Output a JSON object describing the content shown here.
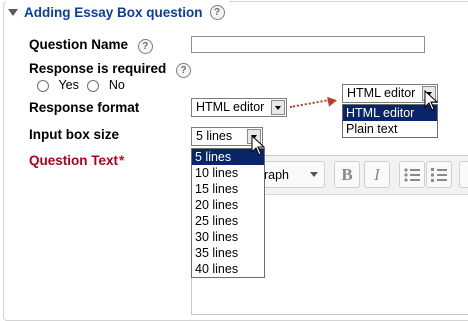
{
  "section": {
    "title": "Adding Essay Box question"
  },
  "fields": {
    "question_name": {
      "label": "Question Name",
      "value": ""
    },
    "response_required": {
      "label": "Response is required",
      "options": [
        "Yes",
        "No"
      ]
    },
    "response_format": {
      "label": "Response format",
      "value": "HTML editor"
    },
    "input_box_size": {
      "label": "Input box size",
      "value": "5 lines"
    },
    "question_text": {
      "label": "Question Text",
      "required_mark": "*"
    }
  },
  "response_format_dropdown": {
    "value": "HTML editor",
    "options": [
      "HTML editor",
      "Plain text"
    ],
    "highlighted": "HTML editor"
  },
  "input_box_dropdown": {
    "options": [
      "5 lines",
      "10 lines",
      "15 lines",
      "20 lines",
      "25 lines",
      "30 lines",
      "35 lines",
      "40 lines"
    ],
    "highlighted": "5 lines"
  },
  "editor_toolbar": {
    "format_select": "graph",
    "bold": "B",
    "italic": "I"
  },
  "colors": {
    "legend": "#0a3da0",
    "required_label": "#b0001c",
    "highlight": "#0a246a",
    "arrow": "#c0392b"
  }
}
